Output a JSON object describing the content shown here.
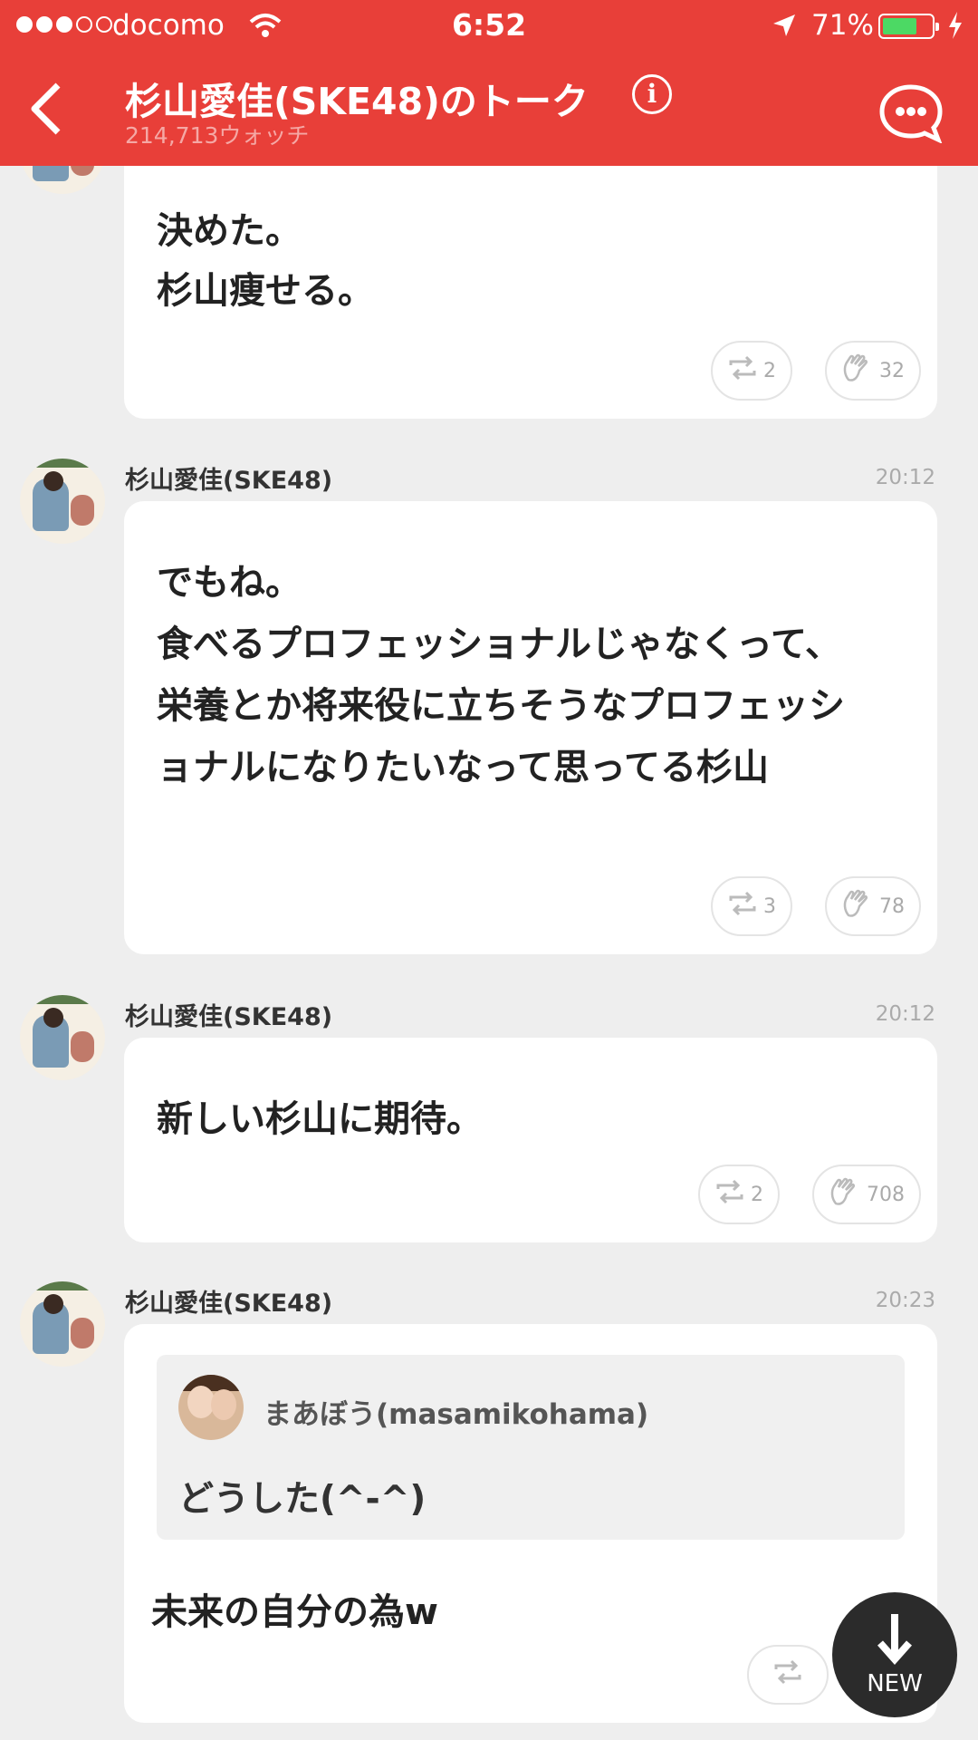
{
  "status_bar": {
    "carrier": "docomo",
    "time": "6:52",
    "battery_pct": "71%",
    "battery_level": 0.71,
    "signal_full": 3,
    "signal_total": 5
  },
  "header": {
    "title": "杉山愛佳(SKE48)のトーク",
    "watch_count": "214,713ウォッチ",
    "bg_color": "#e83f39"
  },
  "posts": [
    {
      "text": "決めた。\n杉山痩せる。",
      "retweets": "2",
      "claps": "32"
    },
    {
      "author": "杉山愛佳(SKE48)",
      "time": "20:12",
      "text": "でもね。\n食べるプロフェッショナルじゃなくって、\n栄養とか将来役に立ちそうなプロフェッシ\nョナルになりたいなって思ってる杉山",
      "retweets": "3",
      "claps": "78"
    },
    {
      "author": "杉山愛佳(SKE48)",
      "time": "20:12",
      "text": "新しい杉山に期待。",
      "retweets": "2",
      "claps": "708"
    },
    {
      "author": "杉山愛佳(SKE48)",
      "time": "20:23",
      "quote": {
        "author": "まあぼう(masamikohama)",
        "text": "どうした(^-^)"
      },
      "text": "未来の自分の為w"
    }
  ],
  "new_button": {
    "label": "NEW"
  },
  "icons": [
    "back-icon",
    "info-icon",
    "talk-options-icon",
    "retweet-icon",
    "clap-icon",
    "down-arrow-icon",
    "wifi-icon",
    "location-icon",
    "battery-icon",
    "charging-icon"
  ]
}
